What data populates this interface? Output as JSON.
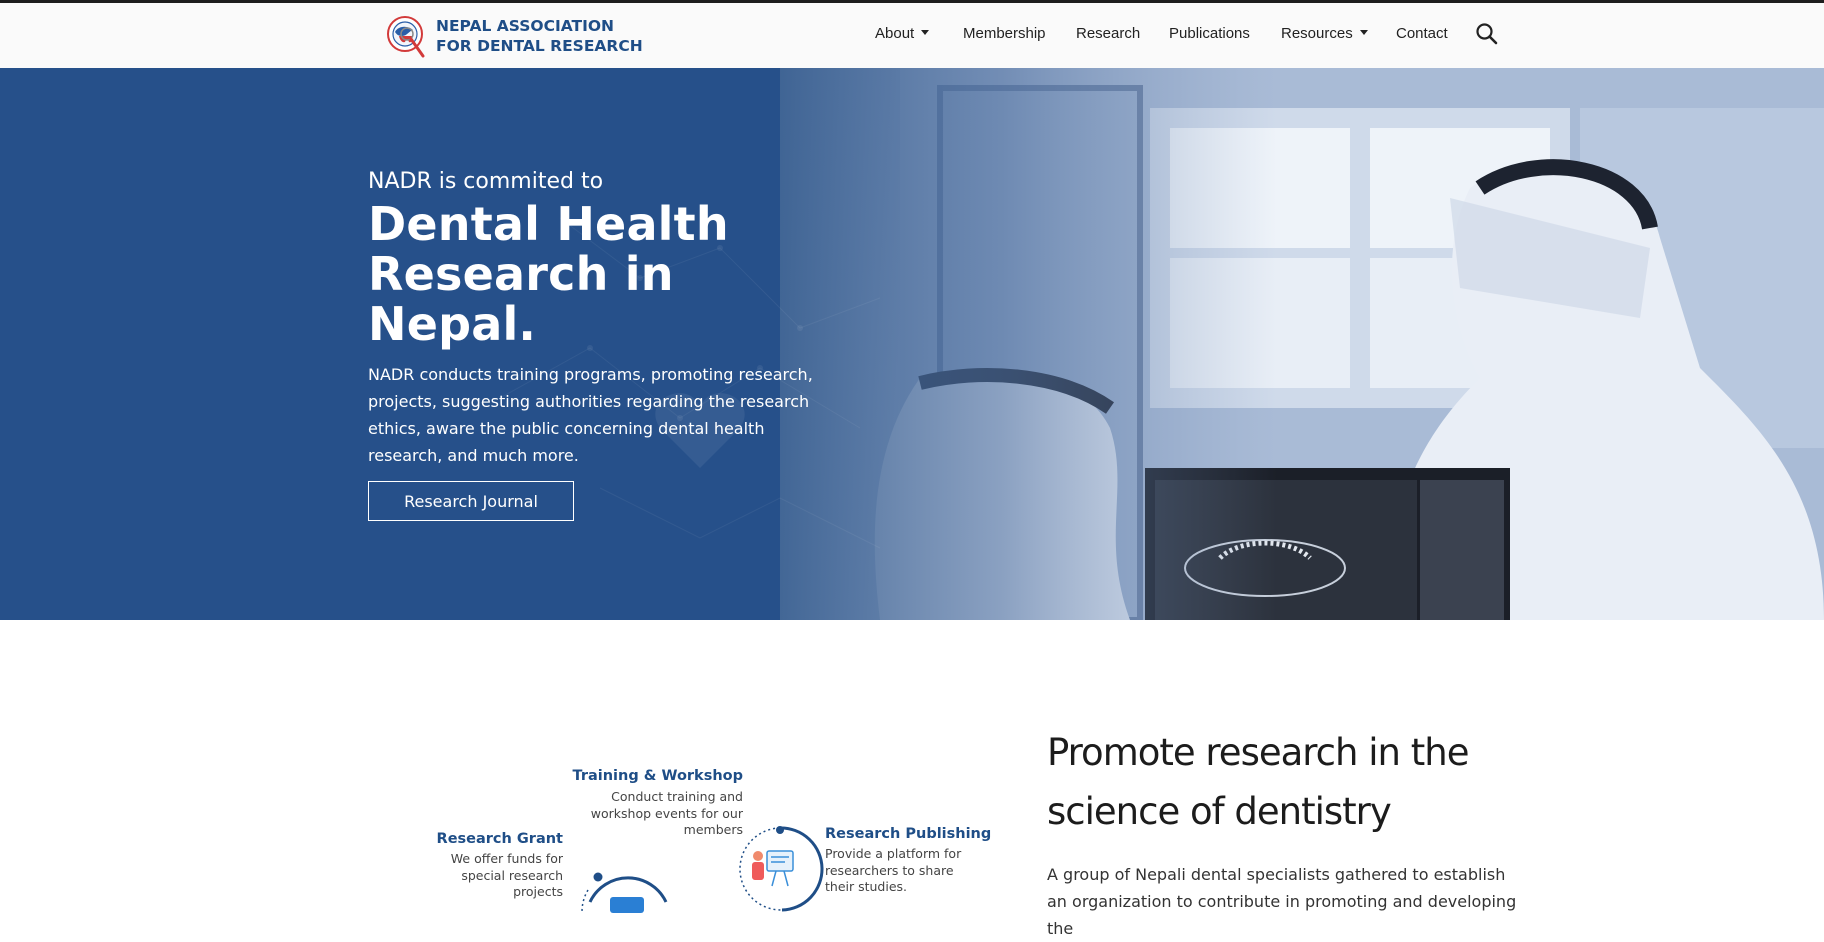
{
  "header": {
    "org_name_line1": "NEPAL ASSOCIATION",
    "org_name_line2": "FOR DENTAL RESEARCH",
    "nav": [
      {
        "label": "About",
        "dropdown": true
      },
      {
        "label": "Membership",
        "dropdown": false
      },
      {
        "label": "Research",
        "dropdown": false
      },
      {
        "label": "Publications",
        "dropdown": false
      },
      {
        "label": "Resources",
        "dropdown": true
      },
      {
        "label": "Contact",
        "dropdown": false
      }
    ],
    "search_icon": "search-icon"
  },
  "hero": {
    "eyebrow": "NADR is commited to",
    "headline_line1": "Dental Health",
    "headline_line2": "Research in Nepal.",
    "description": "NADR conducts training programs, promoting research, projects, suggesting authorities regarding the research ethics, aware the public concerning dental health research, and much more.",
    "button_label": "Research Journal"
  },
  "services": [
    {
      "title": "Training & Workshop",
      "description": "Conduct training and workshop events for our members"
    },
    {
      "title": "Research Grant",
      "description": "We offer funds for special research projects"
    },
    {
      "title": "Research Publishing",
      "description": "Provide a platform for researchers to share their studies."
    }
  ],
  "feature": {
    "title_line1": "Promote research in the",
    "title_line2": "science of dentistry",
    "description": "A group of Nepali dental specialists gathered to establish an organization to contribute in promoting and developing the"
  },
  "colors": {
    "brand_blue": "#1f4e87",
    "hero_blue": "#2a5183",
    "nav_bg": "#fafafa",
    "white": "#ffffff"
  }
}
